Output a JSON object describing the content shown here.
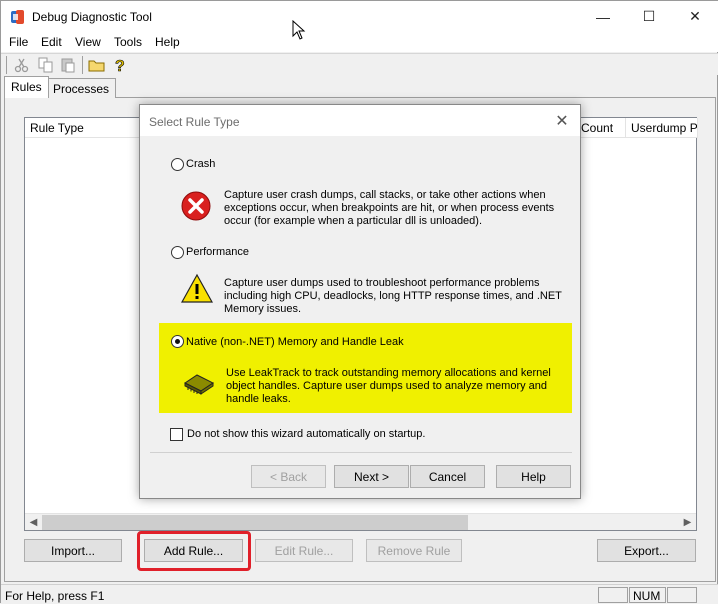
{
  "window": {
    "title": "Debug Diagnostic Tool",
    "caption_buttons": {
      "minimize": "—",
      "maximize": "☐",
      "close": "✕"
    }
  },
  "menu": [
    "File",
    "Edit",
    "View",
    "Tools",
    "Help"
  ],
  "toolbar": {
    "icons": [
      "cut-icon",
      "copy-icon",
      "paste-icon",
      "open-folder-icon",
      "help-icon"
    ]
  },
  "tabs": [
    {
      "label": "Rules",
      "selected": true
    },
    {
      "label": "Processes",
      "selected": false
    }
  ],
  "list": {
    "columns": [
      "Rule Type",
      "Count",
      "Userdump Pa"
    ]
  },
  "buttons": {
    "import": "Import...",
    "add_rule": "Add Rule...",
    "edit_rule": "Edit Rule...",
    "remove_rule": "Remove Rule",
    "export": "Export..."
  },
  "statusbar": {
    "text": "For Help, press F1",
    "num": "NUM"
  },
  "dialog": {
    "title": "Select Rule Type",
    "options": [
      {
        "label": "Crash",
        "description": "Capture user crash dumps, call stacks, or take other actions when exceptions occur, when breakpoints are hit, or when process events occur (for example when a particular dll is unloaded).",
        "icon": "error-icon",
        "selected": false
      },
      {
        "label": "Performance",
        "description": "Capture user dumps used to troubleshoot performance problems including high CPU, deadlocks, long HTTP response times, and .NET Memory issues.",
        "icon": "warning-icon",
        "selected": false
      },
      {
        "label": "Native (non-.NET) Memory and Handle Leak",
        "description": "Use LeakTrack to track outstanding memory allocations and kernel object handles. Capture user dumps used to analyze memory and handle leaks.",
        "icon": "memory-chip-icon",
        "selected": true
      }
    ],
    "checkbox_label": "Do not show this wizard automatically on startup.",
    "buttons": {
      "back": "< Back",
      "next": "Next >",
      "cancel": "Cancel",
      "help": "Help"
    },
    "highlight_color": "#f0f000"
  },
  "colors": {
    "annotation_red": "#e0202a"
  }
}
